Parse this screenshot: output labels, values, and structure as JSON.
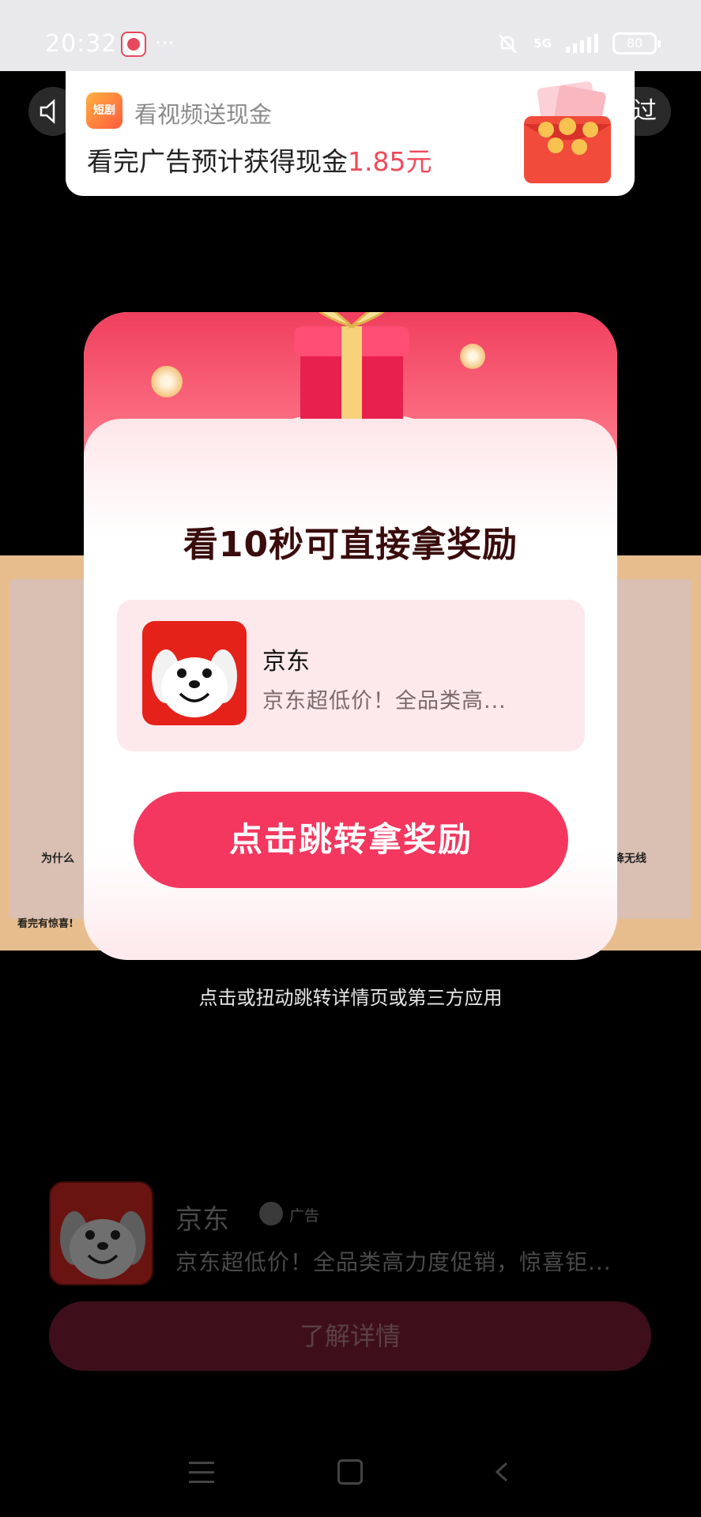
{
  "status_bar": {
    "time": "20:32",
    "more": "···",
    "network": "5G",
    "battery": "80"
  },
  "skip_label": "过",
  "banner": {
    "icon_label": "短剧",
    "title": "看视频送现金",
    "desc_prefix": "看完广告预计获得现金",
    "amount": "1.85元"
  },
  "video": {
    "caption_left": "为什么",
    "caption_right": "降无线",
    "caption_bottom": "看完有惊喜!"
  },
  "modal": {
    "title": "看10秒可直接拿奖励",
    "app_name": "京东",
    "app_desc": "京东超低价！全品类高...",
    "cta_label": "点击跳转拿奖励"
  },
  "hint": "点击或扭动跳转详情页或第三方应用",
  "bottom": {
    "app_name": "京东",
    "ad_label": "广告",
    "desc": "京东超低价！全品类高力度促销，惊喜钜...",
    "learn_more": "了解详情"
  },
  "colors": {
    "accent": "#f3375f",
    "jd_red": "#e5221a",
    "amount": "#f04a5a"
  },
  "icons": [
    "bell-off-icon",
    "signal-icon",
    "battery-icon",
    "mute-icon",
    "gift-icon",
    "jd-dog-icon",
    "ad-mark-icon",
    "menu-icon",
    "home-icon",
    "back-icon"
  ]
}
